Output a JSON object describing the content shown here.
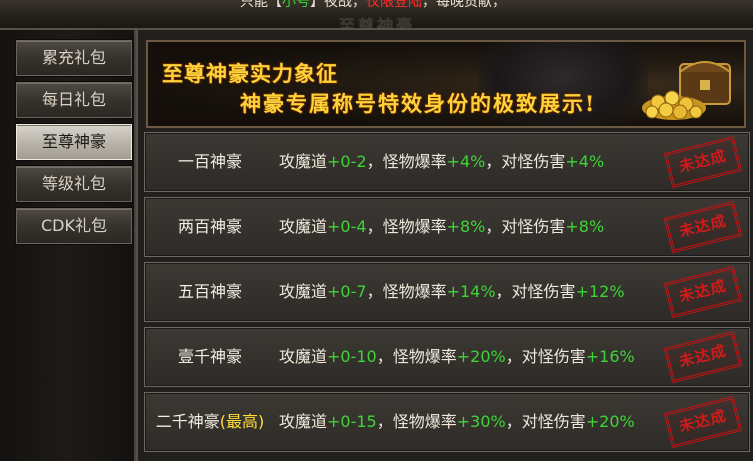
{
  "top_notice": {
    "prefix": "只能【",
    "green": "小号",
    "mid": "】夜战，",
    "red": "仅限登陆",
    "suffix": "，每晚贡献，"
  },
  "window_title": "至尊神豪",
  "sidebar": {
    "items": [
      {
        "label": "累充礼包",
        "active": false
      },
      {
        "label": "每日礼包",
        "active": false
      },
      {
        "label": "至尊神豪",
        "active": true
      },
      {
        "label": "等级礼包",
        "active": false
      },
      {
        "label": "CDK礼包",
        "active": false
      }
    ]
  },
  "banner": {
    "line1": "至尊神豪实力象征",
    "line2": "神豪专属称号特效身份的极致展示!"
  },
  "tiers": [
    {
      "name": "一百神豪",
      "highlight": "",
      "a_label": "攻魔道",
      "a_value": "+0-2",
      "b_label": "，怪物爆率",
      "b_value": "+4%",
      "c_label": "，对怪伤害",
      "c_value": "+4%",
      "status": "未达成"
    },
    {
      "name": "两百神豪",
      "highlight": "",
      "a_label": "攻魔道",
      "a_value": "+0-4",
      "b_label": "，怪物爆率",
      "b_value": "+8%",
      "c_label": "，对怪伤害",
      "c_value": "+8%",
      "status": "未达成"
    },
    {
      "name": "五百神豪",
      "highlight": "",
      "a_label": "攻魔道",
      "a_value": "+0-7",
      "b_label": "，怪物爆率",
      "b_value": "+14%",
      "c_label": "，对怪伤害",
      "c_value": "+12%",
      "status": "未达成"
    },
    {
      "name": "壹千神豪",
      "highlight": "",
      "a_label": "攻魔道",
      "a_value": "+0-10",
      "b_label": "，怪物爆率",
      "b_value": "+20%",
      "c_label": "，对怪伤害",
      "c_value": "+16%",
      "status": "未达成"
    },
    {
      "name": "二千神豪",
      "highlight": "(最高)",
      "a_label": "攻魔道",
      "a_value": "+0-15",
      "b_label": "，怪物爆率",
      "b_value": "+30%",
      "c_label": "，对怪伤害",
      "c_value": "+20%",
      "status": "未达成"
    }
  ],
  "colors": {
    "accent_green": "#3ed436",
    "stamp_red": "#c21515",
    "banner_gold": "#ffd23a"
  }
}
